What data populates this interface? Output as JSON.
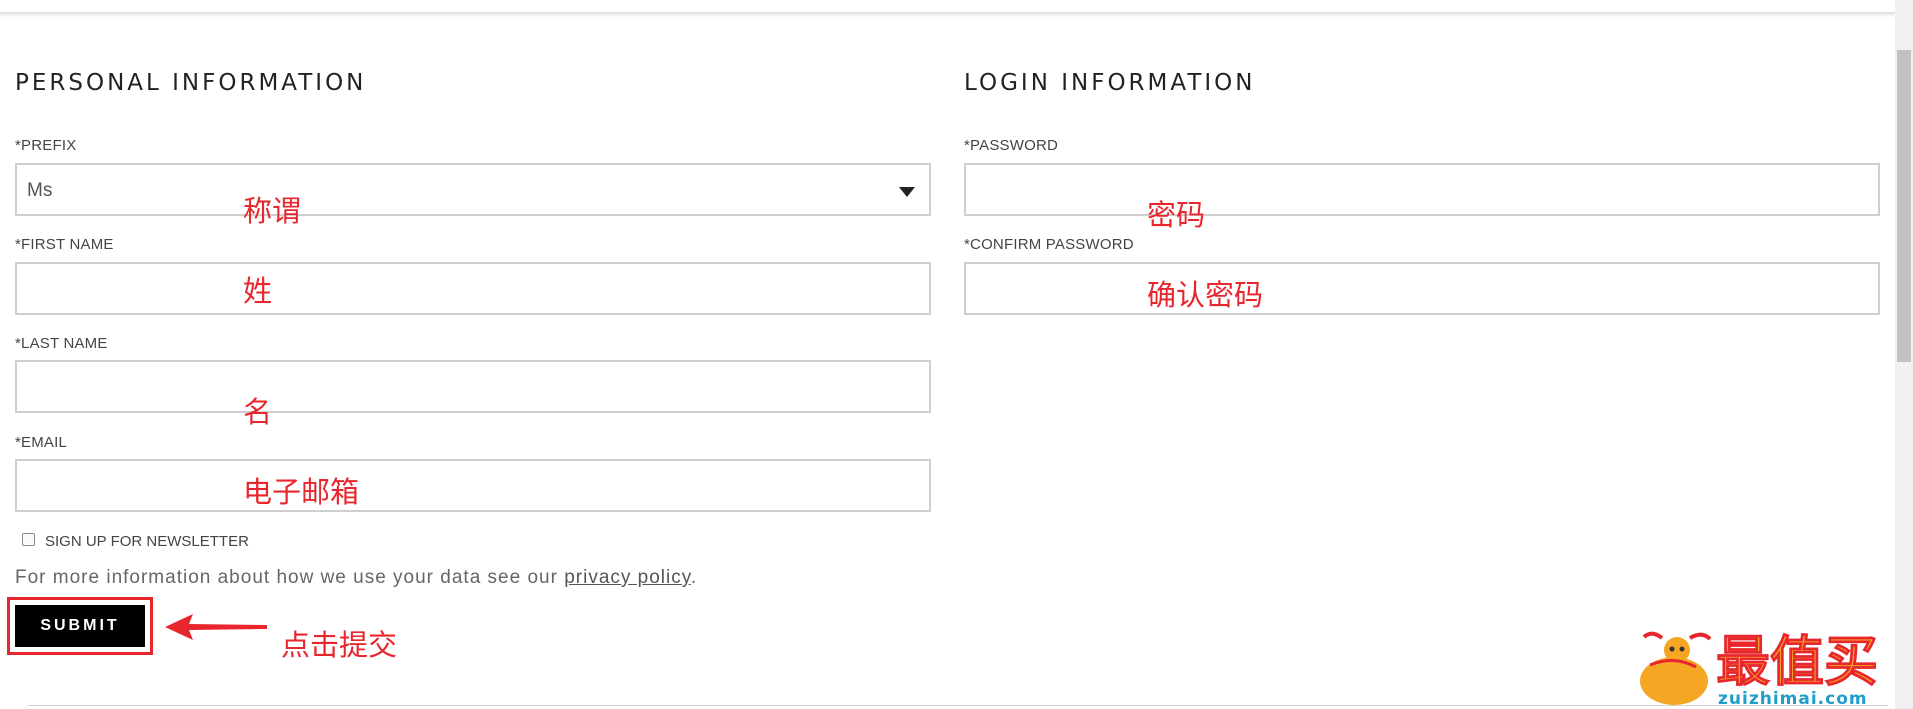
{
  "personal_section": {
    "title": "PERSONAL INFORMATION",
    "prefix": {
      "label": "*PREFIX",
      "value": "Ms"
    },
    "first_name": {
      "label": "*FIRST NAME",
      "value": ""
    },
    "last_name": {
      "label": "*LAST NAME",
      "value": ""
    },
    "email": {
      "label": "*EMAIL",
      "value": ""
    },
    "newsletter": {
      "label": "SIGN UP FOR NEWSLETTER",
      "checked": false
    },
    "info_prefix": "For more information about how we use your data see our ",
    "privacy_link": "privacy policy",
    "info_suffix": ".",
    "submit_label": "SUBMIT"
  },
  "login_section": {
    "title": "LOGIN INFORMATION",
    "password": {
      "label": "*PASSWORD",
      "value": ""
    },
    "confirm_password": {
      "label": "*CONFIRM PASSWORD",
      "value": ""
    }
  },
  "annotations": {
    "prefix": "称谓",
    "first_name": "姓",
    "last_name": "名",
    "email": "电子邮箱",
    "password": "密码",
    "confirm_password": "确认密码",
    "submit": "点击提交"
  },
  "watermark": {
    "brand": "最值买",
    "domain": "zuizhimai.com"
  },
  "colors": {
    "annotation_red": "#e8262d",
    "submit_bg": "#000000",
    "field_border": "#cfcfcf",
    "logo_orange": "#f5a623"
  },
  "icons": {
    "prefix_dropdown": "caret-down-icon",
    "annotation_arrow": "left-arrow-icon",
    "logo": "gourd-mascot-logo"
  }
}
